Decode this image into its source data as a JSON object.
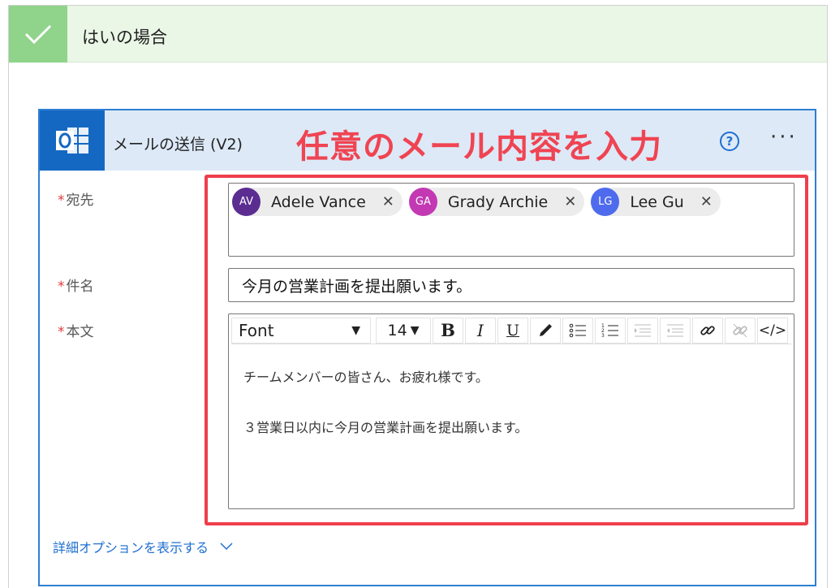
{
  "condition": {
    "title": "はいの場合"
  },
  "action": {
    "title": "メールの送信 (V2)",
    "annotation": "任意のメール内容を入力",
    "help_icon": "question-circle-icon",
    "more_icon": "ellipsis-icon"
  },
  "fields": {
    "to": {
      "label": "宛先",
      "required": "*",
      "recipients": [
        {
          "initials": "AV",
          "name": "Adele Vance",
          "color": "#5b2d90"
        },
        {
          "initials": "GA",
          "name": "Grady Archie",
          "color": "#c239b3"
        },
        {
          "initials": "LG",
          "name": "Lee Gu",
          "color": "#4f6bed"
        }
      ]
    },
    "subject": {
      "label": "件名",
      "required": "*",
      "value": "今月の営業計画を提出願います。"
    },
    "body": {
      "label": "本文",
      "required": "*",
      "toolbar": {
        "font": "Font",
        "size": "14"
      },
      "lines": [
        "チームメンバーの皆さん、お疲れ様です。",
        "３営業日以内に今月の営業計画を提出願います。"
      ]
    }
  },
  "advanced_options": {
    "label": "詳細オプションを表示する"
  },
  "colors": {
    "accent": "#1e6fd0",
    "annotation": "#ef3e4c",
    "success": "#8fd48a"
  }
}
